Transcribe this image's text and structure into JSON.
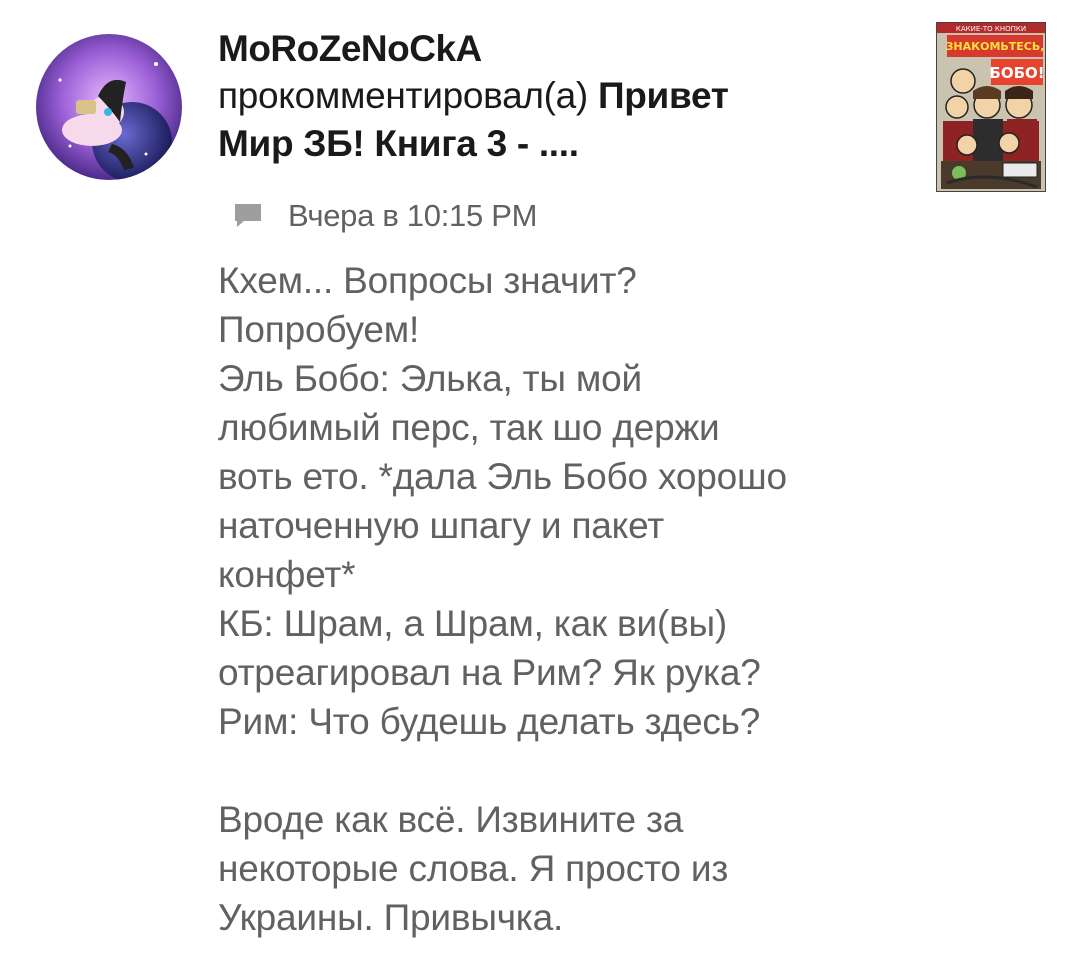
{
  "notification": {
    "user": {
      "name": "MoRoZeNoCkA",
      "avatar_icon": "pony-avatar-icon"
    },
    "action": "прокомментировал(а)",
    "post_title_line1": "Привет",
    "post_title_line2": "Мир ЗБ! Книга 3 - ....",
    "timestamp": "Вчера в 10:15 PM",
    "thumbnail": {
      "banner_top": "КАКИЕ-ТО КНОПКИ",
      "banner_main": "ЗНАКОМЬТЕСЬ,",
      "banner_name": "БОБО!"
    },
    "comment_lines_1": [
      "Кхем... Вопросы значит?",
      "Попробуем!",
      "Эль Бобо: Элька, ты мой",
      "любимый перс, так шо держи",
      "воть ето. *дала Эль Бобо хорошо",
      "наточенную шпагу и пакет",
      "конфет*",
      "КБ: Шрам, а Шрам, как ви(вы)",
      "отреагировал на Рим? Як рука?",
      "Рим: Что будешь делать здесь?"
    ],
    "comment_lines_2": [
      "Вроде как всё. Извините за",
      "некоторые слова. Я просто из",
      "Украины. Привычка."
    ]
  }
}
